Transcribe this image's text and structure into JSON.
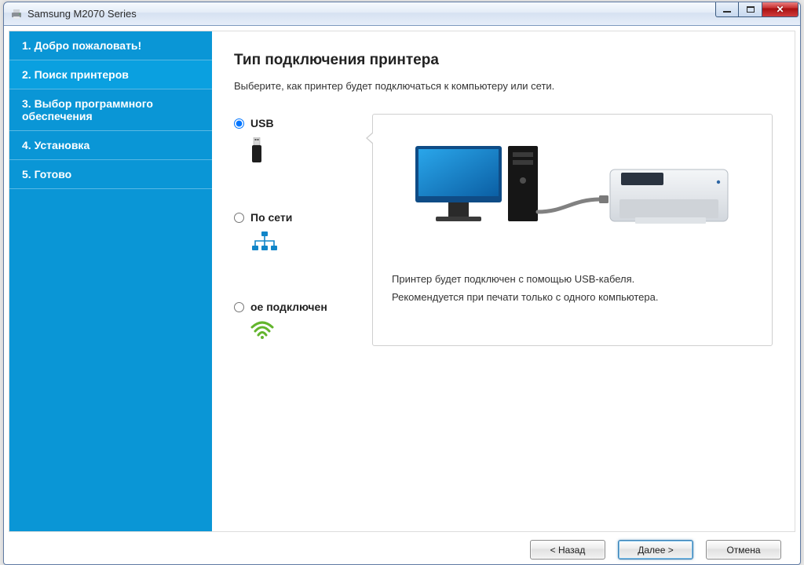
{
  "window": {
    "title": "Samsung M2070 Series"
  },
  "sidebar": {
    "steps": [
      {
        "label": "1. Добро пожаловать!"
      },
      {
        "label": "2. Поиск принтеров"
      },
      {
        "label": "3. Выбор программного обеспечения"
      },
      {
        "label": "4. Установка"
      },
      {
        "label": "5. Готово"
      }
    ],
    "active_index": 1
  },
  "content": {
    "heading": "Тип подключения принтера",
    "subtitle": "Выберите, как принтер будет подключаться к компьютеру или сети.",
    "options": {
      "usb": {
        "label": "USB"
      },
      "network": {
        "label": "По сети"
      },
      "wireless": {
        "label": "ое подключен"
      }
    },
    "selected": "usb",
    "preview": {
      "line1": "Принтер будет подключен с помощью USB-кабеля.",
      "line2": "Рекомендуется при печати только с одного компьютера."
    }
  },
  "footer": {
    "back": "< Назад",
    "next": "Далее >",
    "cancel": "Отмена"
  }
}
